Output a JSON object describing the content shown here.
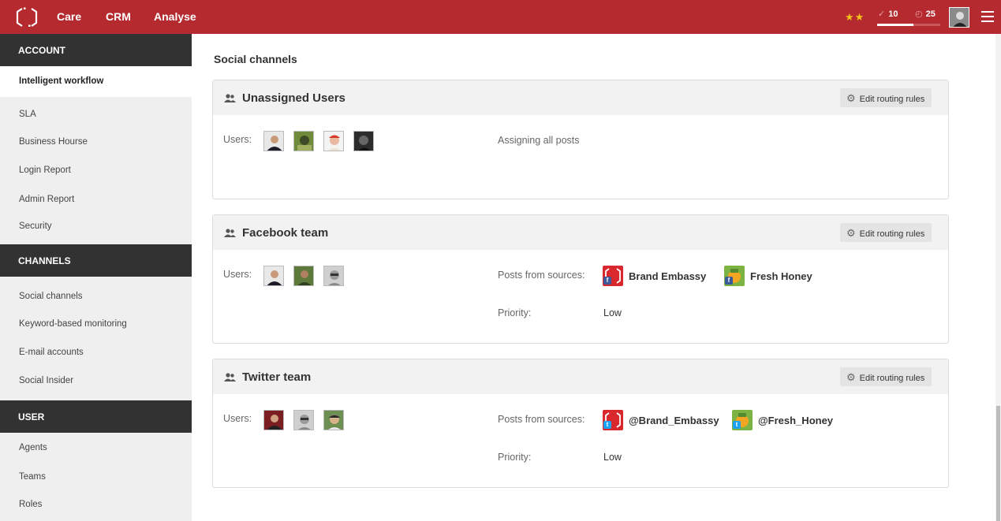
{
  "app": {
    "nav": [
      "Care",
      "CRM",
      "Analyse"
    ],
    "stats": {
      "checks": "10",
      "timer": "25",
      "checks_progress": 0.58
    },
    "stars": "★★"
  },
  "sidebar": {
    "sections": [
      {
        "title": "ACCOUNT"
      },
      {
        "title": "CHANNELS"
      },
      {
        "title": "USER"
      }
    ],
    "active_item": "Intelligent workflow",
    "account_items": [
      "SLA",
      "Business Hourse",
      "Login Report",
      "Admin Report",
      "Security"
    ],
    "channel_items": [
      "Social channels",
      "Keyword-based monitoring",
      "E-mail accounts",
      "Social Insider"
    ],
    "user_items": [
      "Agents",
      "Teams",
      "Roles"
    ]
  },
  "main": {
    "title": "Social channels",
    "edit_label": "Edit routing rules",
    "users_label": "Users:",
    "sources_label": "Posts from sources:",
    "priority_label": "Priority:",
    "cards": [
      {
        "title": "Unassigned Users",
        "assignment": "Assigning all posts"
      },
      {
        "title": "Facebook team",
        "sources": [
          {
            "name": "Brand Embassy",
            "network": "facebook"
          },
          {
            "name": "Fresh Honey",
            "network": "facebook"
          }
        ],
        "priority": "Low"
      },
      {
        "title": "Twitter team",
        "sources": [
          {
            "name": "@Brand_Embassy",
            "network": "twitter"
          },
          {
            "name": "@Fresh_Honey",
            "network": "twitter"
          }
        ],
        "priority": "Low"
      }
    ]
  },
  "colors": {
    "brand": "#b42a2e",
    "sidebar_dark": "#323232",
    "facebook": "#3b5998",
    "twitter": "#1da1f2"
  }
}
